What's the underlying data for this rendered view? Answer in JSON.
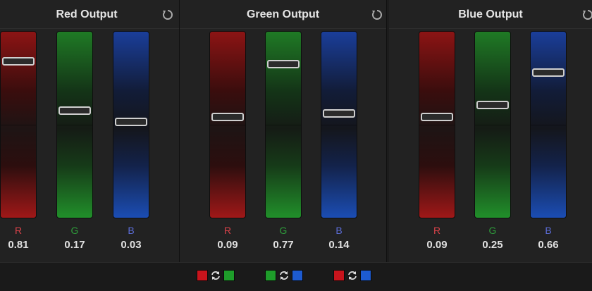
{
  "colors": {
    "red": "#c8141c",
    "green": "#1e9d2a",
    "blue": "#1d5bd1"
  },
  "icons": {
    "reset": "reset-icon",
    "swap": "swap-icon"
  },
  "panels": [
    {
      "title": "Red Output",
      "channels": [
        {
          "label": "R",
          "value": "0.81",
          "level": 0.81
        },
        {
          "label": "G",
          "value": "0.17",
          "level": 0.17
        },
        {
          "label": "B",
          "value": "0.03",
          "level": 0.03
        }
      ]
    },
    {
      "title": "Green Output",
      "channels": [
        {
          "label": "R",
          "value": "0.09",
          "level": 0.09
        },
        {
          "label": "G",
          "value": "0.77",
          "level": 0.77
        },
        {
          "label": "B",
          "value": "0.14",
          "level": 0.14
        }
      ]
    },
    {
      "title": "Blue Output",
      "channels": [
        {
          "label": "R",
          "value": "0.09",
          "level": 0.09
        },
        {
          "label": "G",
          "value": "0.25",
          "level": 0.25
        },
        {
          "label": "B",
          "value": "0.66",
          "level": 0.66
        }
      ]
    }
  ],
  "swaps": [
    {
      "from": "red",
      "to": "green"
    },
    {
      "from": "green",
      "to": "blue"
    },
    {
      "from": "red",
      "to": "blue"
    }
  ]
}
